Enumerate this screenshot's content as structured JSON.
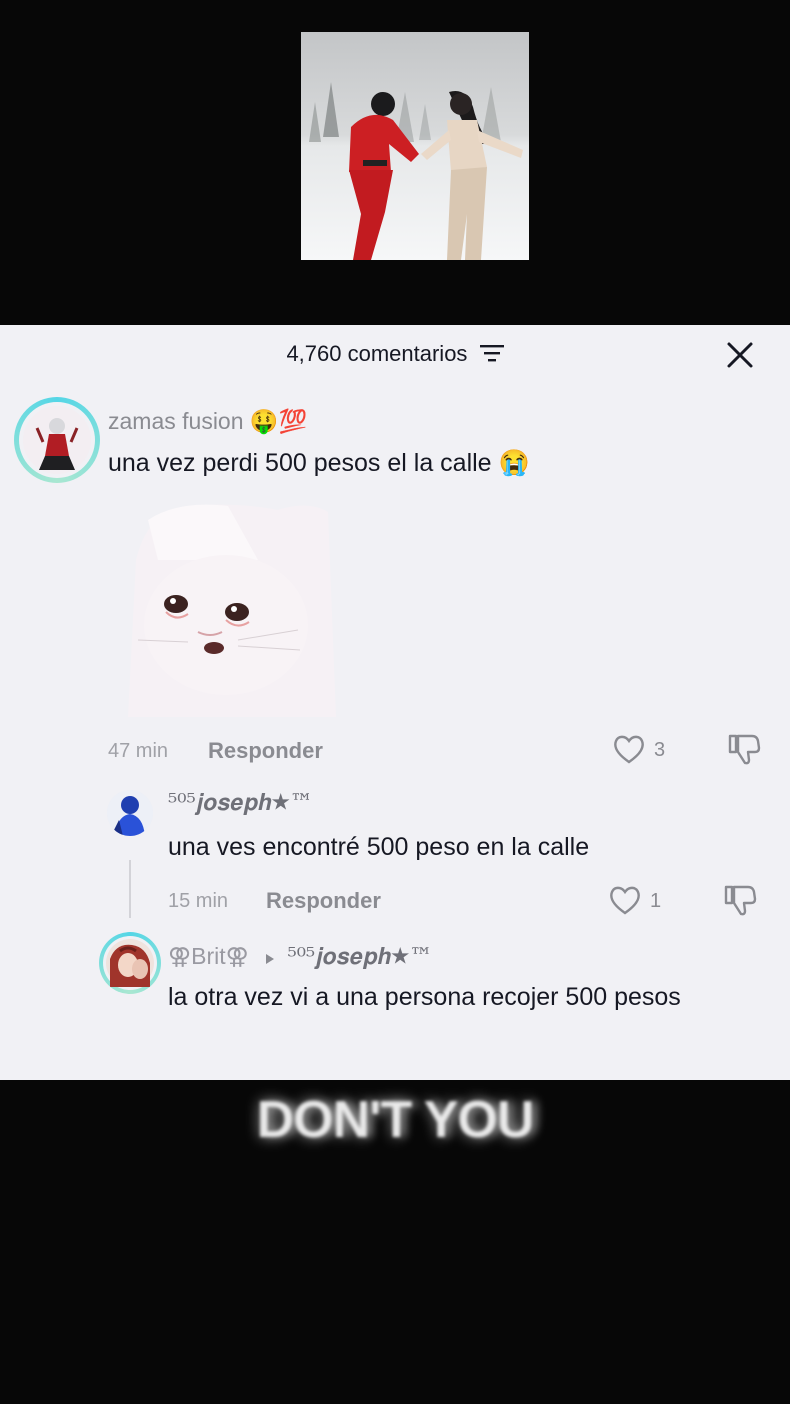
{
  "video": {
    "thumbnail_description_icon": "video-thumbnail"
  },
  "comments_panel": {
    "title": "4,760 comentarios",
    "filter_icon": "filter-icon",
    "close_icon": "close-icon"
  },
  "comments": [
    {
      "username": "zamas fusion 🤑💯",
      "text": "una vez perdi 500 pesos el la calle 😭",
      "time": "47 min",
      "reply_label": "Responder",
      "likes": "3"
    },
    {
      "username": "⁵⁰⁵𝒋𝒐𝒔𝒆𝒑𝒉★™",
      "text": "una ves encontré 500 peso en la calle",
      "time": "15 min",
      "reply_label": "Responder",
      "likes": "1"
    },
    {
      "username": "⚢Brit⚢",
      "reply_to": "⁵⁰⁵𝒋𝒐𝒔𝒆𝒑𝒉★™",
      "text": "la otra vez vi a una persona recojer 500 pesos"
    }
  ],
  "overlay_caption": "DON'T YOU"
}
